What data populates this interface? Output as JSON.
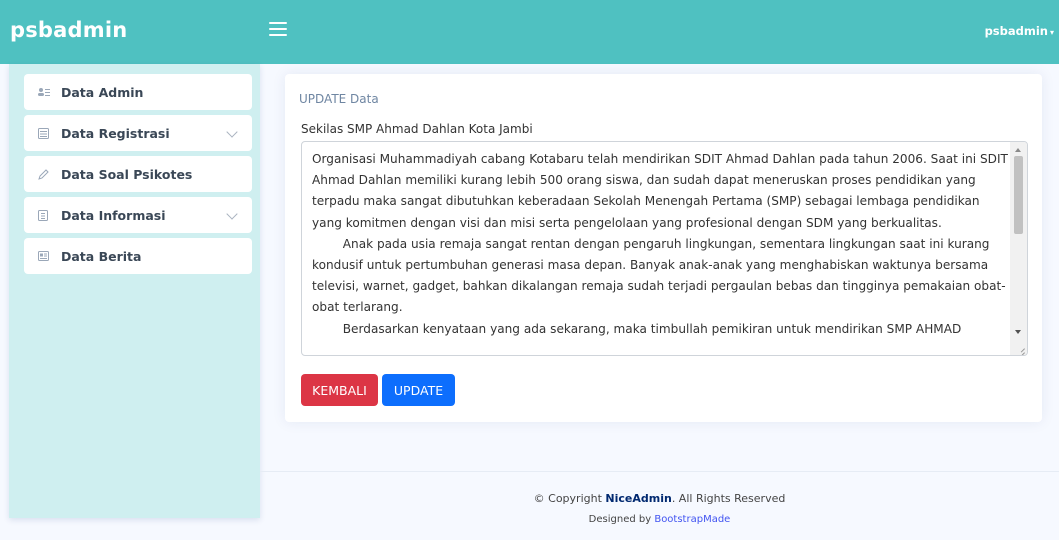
{
  "header": {
    "brand": "psbadmin",
    "user": "psbadmin",
    "user_caret": "▾"
  },
  "sidebar": {
    "items": [
      {
        "label": "Data Admin",
        "icon": "people-icon"
      },
      {
        "label": "Data Registrasi",
        "icon": "layers-icon",
        "has_chevron": true
      },
      {
        "label": "Data Soal Psikotes",
        "icon": "pencil-icon"
      },
      {
        "label": "Data Informasi",
        "icon": "document-icon",
        "has_chevron": true
      },
      {
        "label": "Data Berita",
        "icon": "newspaper-icon"
      }
    ]
  },
  "main": {
    "card_title": "UPDATE Data",
    "field_label": "Sekilas SMP Ahmad Dahlan Kota Jambi",
    "field_value": "Organisasi Muhammadiyah cabang Kotabaru telah mendirikan SDIT Ahmad Dahlan pada tahun 2006. Saat ini SDIT Ahmad Dahlan memiliki kurang lebih 500 orang siswa, dan sudah dapat meneruskan proses pendidikan yang terpadu maka sangat dibutuhkan keberadaan Sekolah Menengah Pertama (SMP) sebagai lembaga pendidikan yang komitmen dengan visi dan misi serta pengelolaan yang profesional dengan SDM yang berkualitas.\n        Anak pada usia remaja sangat rentan dengan pengaruh lingkungan, sementara lingkungan saat ini kurang kondusif untuk pertumbuhan generasi masa depan. Banyak anak-anak yang menghabiskan waktunya bersama televisi, warnet, gadget, bahkan dikalangan remaja sudah terjadi pergaulan bebas dan tingginya pemakaian obat-obat terlarang.\n        Berdasarkan kenyataan yang ada sekarang, maka timbullah pemikiran untuk mendirikan SMP AHMAD",
    "back_button": "KEMBALI",
    "update_button": "UPDATE"
  },
  "footer": {
    "copyright_prefix": "© Copyright ",
    "copyright_brand": "NiceAdmin",
    "copyright_suffix": ". All Rights Reserved",
    "designed_prefix": "Designed by ",
    "designed_link": "BootstrapMade"
  },
  "colors": {
    "topbar": "#4fc1c1",
    "sidebar": "#cfeff0",
    "back_button": "#dc3545",
    "update_button": "#0d6efd"
  }
}
